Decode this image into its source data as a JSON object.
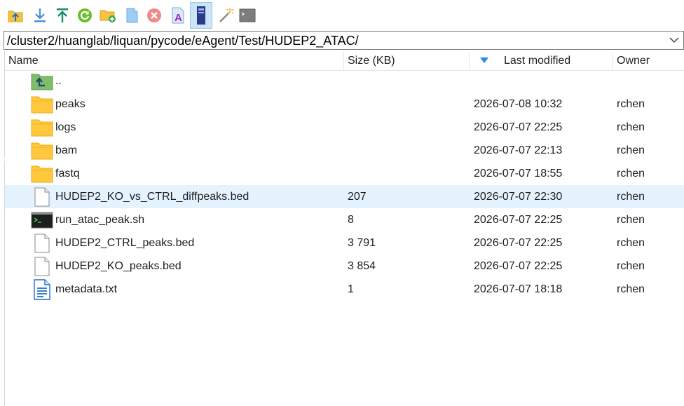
{
  "toolbar": {
    "buttons": [
      {
        "id": "parent-directory",
        "icon": "folder-up-icon"
      },
      {
        "id": "download",
        "icon": "download-arrow-icon"
      },
      {
        "id": "upload",
        "icon": "upload-arrow-icon"
      },
      {
        "id": "refresh",
        "icon": "refresh-icon"
      },
      {
        "id": "new-folder",
        "icon": "new-folder-icon"
      },
      {
        "id": "new-file",
        "icon": "new-file-icon"
      },
      {
        "id": "delete",
        "icon": "delete-icon"
      },
      {
        "id": "rename",
        "icon": "rename-icon"
      },
      {
        "id": "properties",
        "icon": "properties-icon",
        "active": true
      },
      {
        "id": "magic-wand",
        "icon": "magic-wand-icon"
      },
      {
        "id": "terminal",
        "icon": "terminal-icon"
      }
    ]
  },
  "path": {
    "value": "/cluster2/huanglab/liquan/pycode/eAgent/Test/HUDEP2_ATAC/"
  },
  "columns": {
    "name": "Name",
    "size": "Size (KB)",
    "modified": "Last modified",
    "owner": "Owner"
  },
  "files": [
    {
      "name": "..",
      "size": "",
      "modified": "",
      "owner": "",
      "icon": "parent-folder-icon"
    },
    {
      "name": "peaks",
      "size": "",
      "modified": "2026-07-08 10:32",
      "owner": "rchen",
      "icon": "folder-icon"
    },
    {
      "name": "logs",
      "size": "",
      "modified": "2026-07-07 22:25",
      "owner": "rchen",
      "icon": "folder-icon"
    },
    {
      "name": "bam",
      "size": "",
      "modified": "2026-07-07 22:13",
      "owner": "rchen",
      "icon": "folder-icon"
    },
    {
      "name": "fastq",
      "size": "",
      "modified": "2026-07-07 18:55",
      "owner": "rchen",
      "icon": "folder-icon"
    },
    {
      "name": "HUDEP2_KO_vs_CTRL_diffpeaks.bed",
      "size": "207",
      "modified": "2026-07-07 22:30",
      "owner": "rchen",
      "icon": "file-icon",
      "selected": true
    },
    {
      "name": "run_atac_peak.sh",
      "size": "8",
      "modified": "2026-07-07 22:25",
      "owner": "rchen",
      "icon": "script-icon"
    },
    {
      "name": "HUDEP2_CTRL_peaks.bed",
      "size": "3 791",
      "modified": "2026-07-07 22:25",
      "owner": "rchen",
      "icon": "file-icon"
    },
    {
      "name": "HUDEP2_KO_peaks.bed",
      "size": "3 854",
      "modified": "2026-07-07 22:25",
      "owner": "rchen",
      "icon": "file-icon"
    },
    {
      "name": "metadata.txt",
      "size": "1",
      "modified": "2026-07-07 18:18",
      "owner": "rchen",
      "icon": "text-file-icon"
    }
  ]
}
